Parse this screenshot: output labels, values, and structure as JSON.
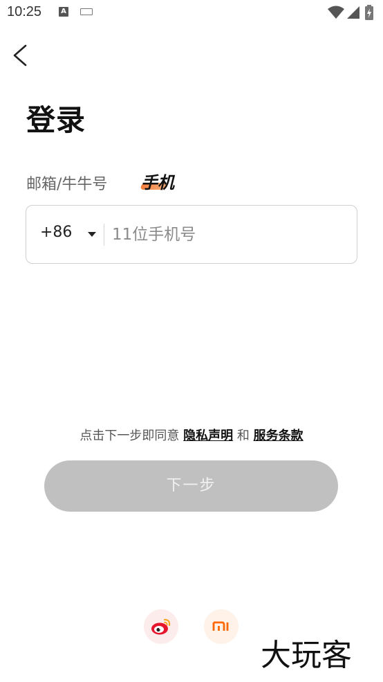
{
  "status_bar": {
    "time": "10:25",
    "a_icon_label": "A"
  },
  "header": {
    "back": "back"
  },
  "title": "登录",
  "tabs": {
    "email": "邮箱/牛牛号",
    "phone": "手机"
  },
  "phone_field": {
    "country_code": "+86",
    "placeholder": "11位手机号",
    "value": ""
  },
  "consent": {
    "prefix": "点击下一步即同意 ",
    "privacy": "隐私声明",
    "and": " 和 ",
    "terms": "服务条款"
  },
  "next_button": "下一步",
  "social": [
    {
      "icon": "weibo-icon",
      "color": "#e6162d"
    },
    {
      "icon": "xiaomi-icon",
      "color": "#ff6700"
    }
  ],
  "watermark": "大玩客",
  "colors": {
    "accent": "#f47c3c",
    "button_disabled": "#c0c0c0"
  }
}
